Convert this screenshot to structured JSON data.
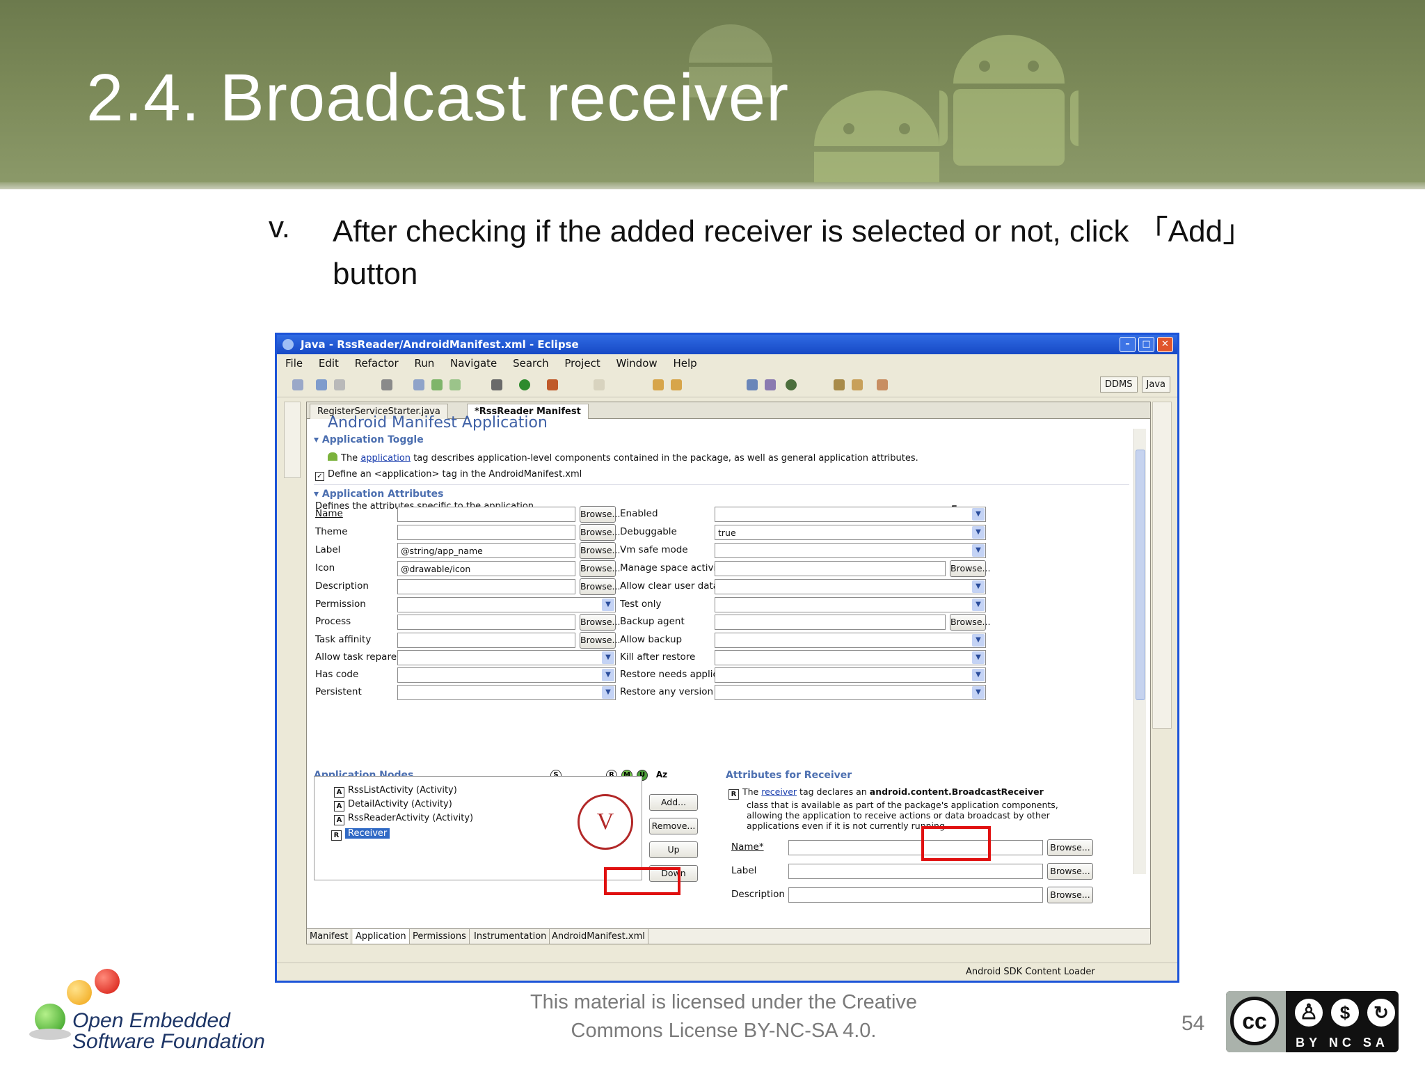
{
  "slide": {
    "title": "2.4. Broadcast receiver",
    "step_number": "v.",
    "step_text": "After checking if the added receiver is selected or not, click 「Add」 button",
    "page_number": "54",
    "license_line1": "This material is licensed under the Creative",
    "license_line2": "Commons License BY-NC-SA 4.0.",
    "logo_line1": "Open Embedded",
    "logo_line2": "Software Foundation",
    "cc_symbol": "cc",
    "cc_badge_labels": "BY NC SA",
    "callout_label": "V",
    "colors": {
      "header_green": "#7b8958",
      "highlight_red": "#e01010",
      "window_blue": "#1c54d8"
    }
  },
  "window": {
    "title": "Java - RssReader/AndroidManifest.xml - Eclipse",
    "menu": [
      "File",
      "Edit",
      "Refactor",
      "Run",
      "Navigate",
      "Search",
      "Project",
      "Window",
      "Help"
    ],
    "perspectives": [
      "DDMS",
      "Java"
    ],
    "editor_tabs": [
      "RegisterServiceStarter.java",
      "*RssReader Manifest"
    ],
    "form_title": "Android Manifest Application",
    "toggle_section": "Application Toggle",
    "toggle_desc_pre": "The",
    "toggle_desc_link": "application",
    "toggle_desc_post": "tag describes application-level components contained in the package, as well as general application attributes.",
    "define_checkbox": "Define an <application> tag in the AndroidManifest.xml",
    "attributes_section": "Application Attributes",
    "attributes_desc": "Defines the attributes specific to the application.",
    "browse_label": "Browse...",
    "left_fields": [
      {
        "label": "Name",
        "value": "",
        "kind": "text"
      },
      {
        "label": "Theme",
        "value": "",
        "kind": "text"
      },
      {
        "label": "Label",
        "value": "@string/app_name",
        "kind": "text"
      },
      {
        "label": "Icon",
        "value": "@drawable/icon",
        "kind": "text"
      },
      {
        "label": "Description",
        "value": "",
        "kind": "text"
      },
      {
        "label": "Permission",
        "value": "",
        "kind": "combo"
      },
      {
        "label": "Process",
        "value": "",
        "kind": "text"
      },
      {
        "label": "Task affinity",
        "value": "",
        "kind": "text"
      },
      {
        "label": "Allow task reparenting",
        "value": "",
        "kind": "combo"
      },
      {
        "label": "Has code",
        "value": "",
        "kind": "combo"
      },
      {
        "label": "Persistent",
        "value": "",
        "kind": "combo"
      }
    ],
    "right_fields": [
      {
        "label": "Enabled",
        "value": "",
        "kind": "combo"
      },
      {
        "label": "Debuggable",
        "value": "true",
        "kind": "combo"
      },
      {
        "label": "Vm safe mode",
        "value": "",
        "kind": "combo"
      },
      {
        "label": "Manage space activity",
        "value": "",
        "kind": "text"
      },
      {
        "label": "Allow clear user data",
        "value": "",
        "kind": "combo"
      },
      {
        "label": "Test only",
        "value": "",
        "kind": "combo"
      },
      {
        "label": "Backup agent",
        "value": "",
        "kind": "text"
      },
      {
        "label": "Allow backup",
        "value": "",
        "kind": "combo"
      },
      {
        "label": "Kill after restore",
        "value": "",
        "kind": "combo"
      },
      {
        "label": "Restore needs application",
        "value": "",
        "kind": "combo"
      },
      {
        "label": "Restore any version",
        "value": "",
        "kind": "combo"
      }
    ],
    "nodes_section": "Application Nodes",
    "nodes": [
      {
        "icon": "A",
        "label": "RssListActivity (Activity)"
      },
      {
        "icon": "A",
        "label": "DetailActivity (Activity)"
      },
      {
        "icon": "A",
        "label": "RssReaderActivity (Activity)"
      },
      {
        "icon": "R",
        "label": "Receiver"
      }
    ],
    "node_buttons": [
      "Add...",
      "Remove...",
      "Up",
      "Down"
    ],
    "node_tool_icons": [
      "S",
      "R",
      "M",
      "U",
      "Az"
    ],
    "receiver_section": "Attributes for Receiver",
    "receiver_icon": "R",
    "receiver_desc_pre": "The",
    "receiver_desc_link": "receiver",
    "receiver_desc_mid": "tag declares an",
    "receiver_desc_bold": "android.content.BroadcastReceiver",
    "receiver_desc_line2": "class that is available as part of the package's application components,",
    "receiver_desc_line3": "allowing the application to receive actions or data broadcast by other",
    "receiver_desc_line4": "applications even if it is not currently running.",
    "receiver_fields": [
      {
        "label": "Name*"
      },
      {
        "label": "Label"
      },
      {
        "label": "Description"
      }
    ],
    "bottom_tabs": [
      "Manifest",
      "Application",
      "Permissions",
      "Instrumentation",
      "AndroidManifest.xml"
    ],
    "status_text": "Android SDK Content Loader"
  }
}
